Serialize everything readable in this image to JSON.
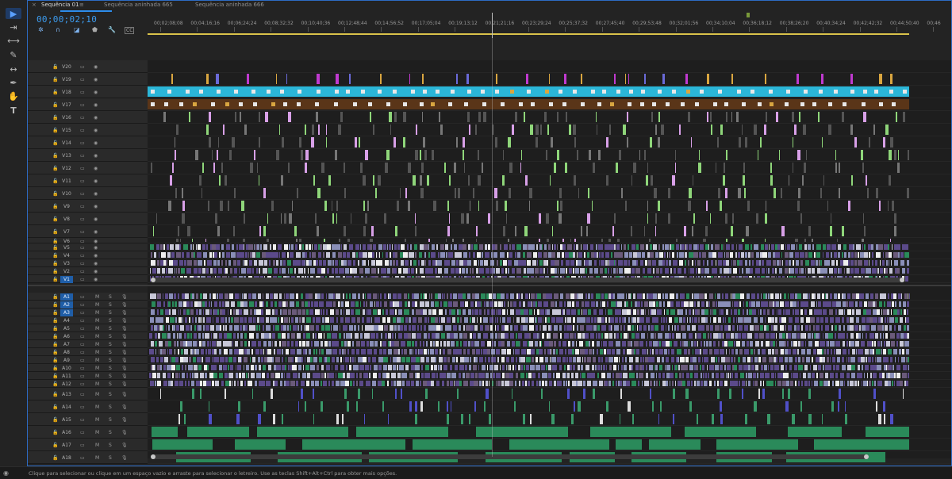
{
  "tabs": [
    {
      "label": "Sequência 01",
      "active": true
    },
    {
      "label": "Sequência aninhada 665",
      "active": false
    },
    {
      "label": "Sequência aninhada 666",
      "active": false
    }
  ],
  "tab_close_glyph": "×",
  "tab_menu_glyph": "≡",
  "timecode": "00;00;02;10",
  "ruler_ticks": [
    "00;02;08;08",
    "00;04;16;16",
    "00;06;24;24",
    "00;08;32;32",
    "00;10;40;36",
    "00;12;48;44",
    "00;14;56;52",
    "00;17;05;04",
    "00;19;13;12",
    "00;21;21;16",
    "00;23;29;24",
    "00;25;37;32",
    "00;27;45;40",
    "00;29;53;48",
    "00;32;01;56",
    "00;34;10;04",
    "00;36;18;12",
    "00;38;26;20",
    "00;40;34;24",
    "00;42;42;32",
    "00;44;50;40",
    "00;46"
  ],
  "video_tracks": [
    "V20",
    "V19",
    "V18",
    "V17",
    "V16",
    "V15",
    "V14",
    "V13",
    "V12",
    "V11",
    "V10",
    "V9",
    "V8",
    "V7",
    "V6",
    "V5",
    "V4",
    "V3",
    "V2",
    "V1"
  ],
  "audio_tracks": [
    "A1",
    "A2",
    "A3",
    "A4",
    "A5",
    "A6",
    "A7",
    "A8",
    "A9",
    "A10",
    "A11",
    "A12",
    "A13",
    "A14",
    "A15",
    "A16",
    "A17",
    "A18"
  ],
  "targeted_video": "V1",
  "targeted_audio": [
    "A1",
    "A2",
    "A3"
  ],
  "source_patch_label": "A1",
  "mute_label": "M",
  "solo_label": "S",
  "status_text": "Clique para selecionar ou clique em um espaço vazio e arraste para selecionar o letreiro. Use as teclas Shift+Alt+Ctrl para obter mais opções.",
  "icons": {
    "toolbar": [
      "selection-tool-icon",
      "track-select-tool-icon",
      "ripple-edit-tool-icon",
      "razor-tool-icon",
      "slip-tool-icon",
      "pen-tool-icon",
      "hand-tool-icon",
      "type-tool-icon"
    ],
    "header": [
      "snap-icon",
      "linked-selection-icon",
      "add-marker-icon",
      "marker-icon",
      "wrench-icon",
      "captions-icon"
    ]
  },
  "colors": {
    "accent": "#2d8ceb",
    "timecode": "#3c9cf0",
    "nested_cyan": "#2bb6d8",
    "nested_brown": "#5a3518",
    "clip_purple": "#5b4a8a",
    "clip_green": "#2a8a5a",
    "clip_magenta": "#c03ad0",
    "clip_yellow": "#d9a640"
  }
}
